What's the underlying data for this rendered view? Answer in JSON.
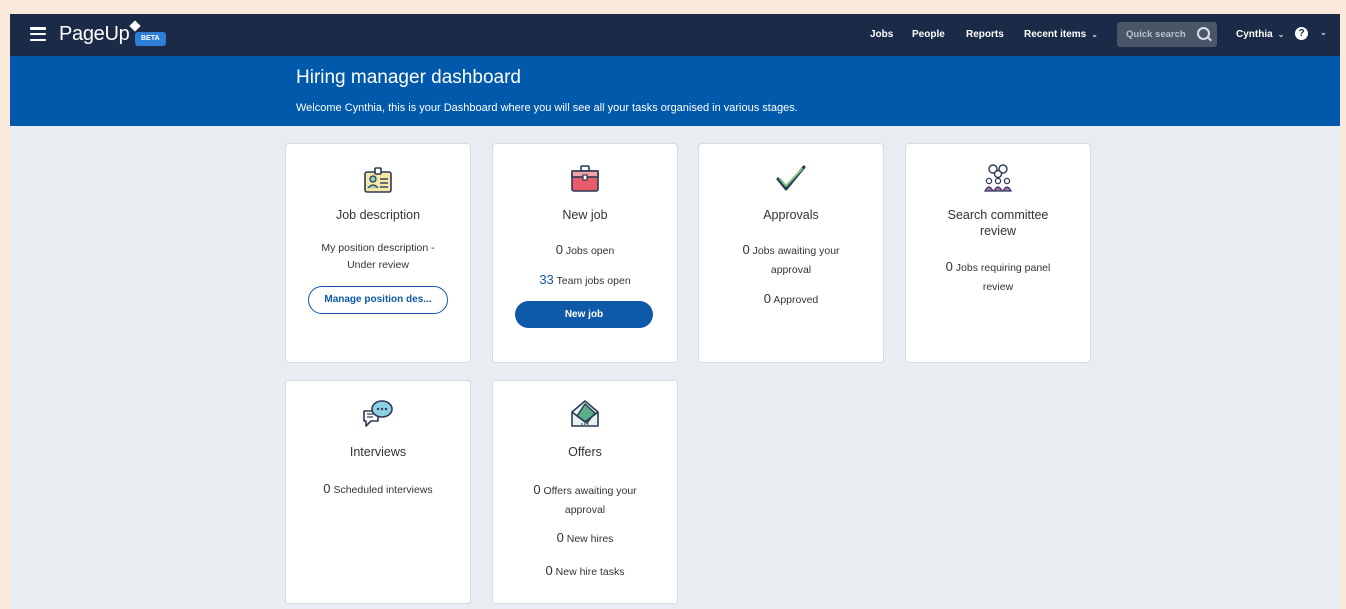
{
  "nav": {
    "brand": "PageUp",
    "beta": "BETA",
    "links": [
      "Jobs",
      "People",
      "Reports"
    ],
    "recent": "Recent items",
    "search_placeholder": "Quick search",
    "user": "Cynthia",
    "help": "?"
  },
  "banner": {
    "title": "Hiring manager dashboard",
    "subtitle": "Welcome Cynthia, this is your Dashboard where you will see all your tasks organised in various stages."
  },
  "cards": {
    "job_description": {
      "title": "Job description",
      "status": "My position description - Under review",
      "button": "Manage position des..."
    },
    "new_job": {
      "title": "New job",
      "jobs_open_count": "0",
      "jobs_open_label": "Jobs open",
      "team_jobs_count": "33",
      "team_jobs_label": "Team jobs open",
      "button": "New job"
    },
    "approvals": {
      "title": "Approvals",
      "awaiting_count": "0",
      "awaiting_label": "Jobs awaiting your approval",
      "approved_count": "0",
      "approved_label": "Approved"
    },
    "search_committee": {
      "title": "Search committee review",
      "count": "0",
      "label": "Jobs requiring panel review"
    },
    "interviews": {
      "title": "Interviews",
      "count": "0",
      "label": "Scheduled interviews"
    },
    "offers": {
      "title": "Offers",
      "awaiting_count": "0",
      "awaiting_label": "Offers awaiting your approval",
      "hires_count": "0",
      "hires_label": "New hires",
      "tasks_count": "0",
      "tasks_label": "New hire tasks"
    }
  },
  "colors": {
    "nav_bg": "#1b2a47",
    "banner_bg": "#0059ab",
    "accent": "#0f5aa8",
    "page_bg": "#e9ecf1"
  }
}
